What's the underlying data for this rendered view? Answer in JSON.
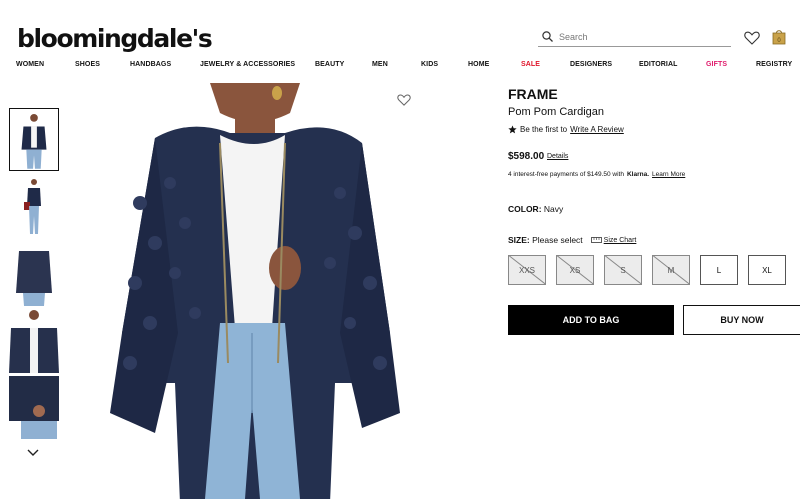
{
  "header": {
    "logo": "bloomingdale's",
    "search_placeholder": "Search",
    "icons": [
      "search-icon",
      "heart-icon",
      "shopping-bag-icon"
    ]
  },
  "nav": {
    "items": [
      "WOMEN",
      "SHOES",
      "HANDBAGS",
      "JEWELRY & ACCESSORIES",
      "BEAUTY",
      "MEN",
      "KIDS",
      "HOME",
      "SALE",
      "DESIGNERS",
      "EDITORIAL",
      "GIFTS",
      "REGISTRY"
    ],
    "highlight_colors": {
      "SALE": "#e0142a",
      "GIFTS": "#e01a6b"
    }
  },
  "gallery": {
    "thumbnail_count": 5,
    "active_thumbnail": 1
  },
  "product": {
    "brand": "FRAME",
    "name": "Pom Pom Cardigan",
    "review_prompt": "Be the first to",
    "review_link": "Write A Review",
    "price": "$598.00",
    "details_link": "Details",
    "klarna_text": "4 interest-free payments of $149.50 with",
    "klarna_brand": "Klarna.",
    "klarna_link": "Learn More",
    "color_label": "COLOR:",
    "color_value": "Navy",
    "size_label": "SIZE:",
    "size_value": "Please select",
    "size_chart_link": "Size Chart",
    "sizes": [
      {
        "label": "XXS",
        "available": false
      },
      {
        "label": "XS",
        "available": false
      },
      {
        "label": "S",
        "available": false
      },
      {
        "label": "M",
        "available": false
      },
      {
        "label": "L",
        "available": true
      },
      {
        "label": "XL",
        "available": true
      }
    ],
    "add_to_bag": "ADD TO BAG",
    "buy_now": "BUY NOW"
  }
}
